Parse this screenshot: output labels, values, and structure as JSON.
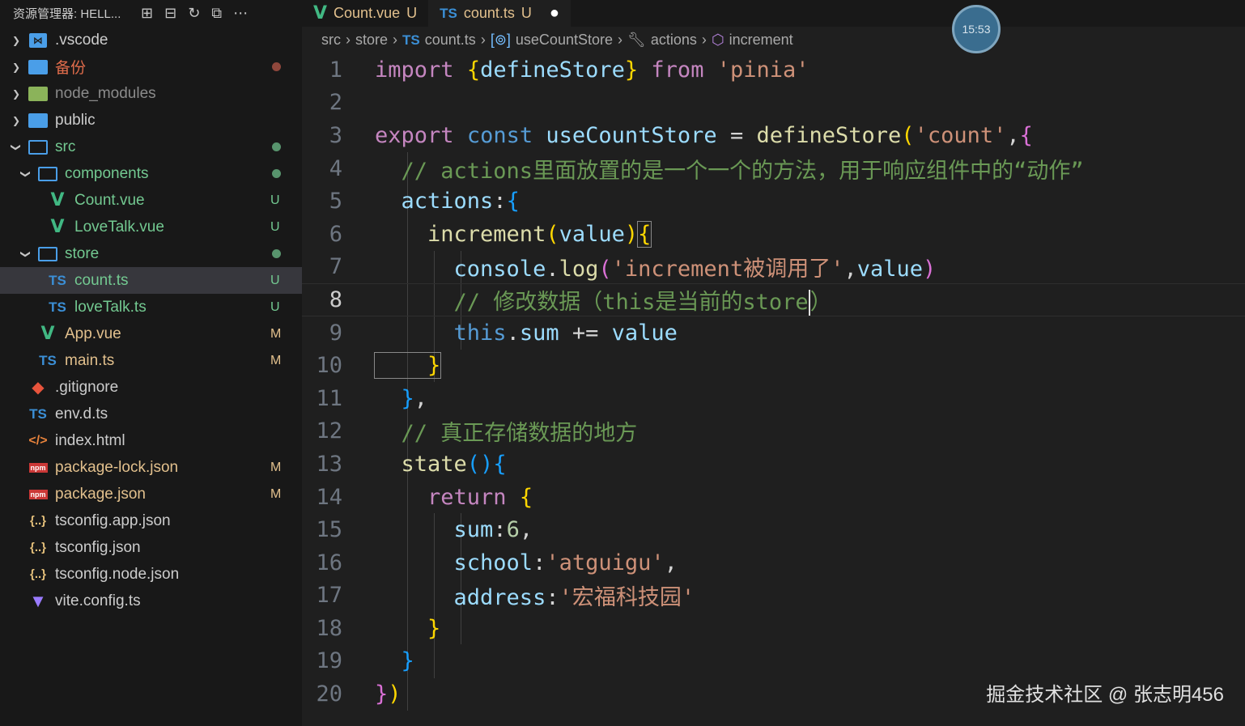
{
  "sidebar": {
    "title": "资源管理器: HELL...",
    "items": [
      {
        "label": ".vscode",
        "color": "#cccccc"
      },
      {
        "label": "备份",
        "color": "#e06c4b"
      },
      {
        "label": "node_modules",
        "color": "#8b8b8b"
      },
      {
        "label": "public",
        "color": "#cccccc"
      },
      {
        "label": "src",
        "color": "#73c991"
      },
      {
        "label": "components",
        "color": "#73c991"
      },
      {
        "label": "Count.vue",
        "color": "#73c991",
        "badge": "U"
      },
      {
        "label": "LoveTalk.vue",
        "color": "#73c991",
        "badge": "U"
      },
      {
        "label": "store",
        "color": "#73c991"
      },
      {
        "label": "count.ts",
        "color": "#73c991",
        "badge": "U"
      },
      {
        "label": "loveTalk.ts",
        "color": "#73c991",
        "badge": "U"
      },
      {
        "label": "App.vue",
        "color": "#e2c08d",
        "badge": "M"
      },
      {
        "label": "main.ts",
        "color": "#e2c08d",
        "badge": "M"
      },
      {
        "label": ".gitignore",
        "color": "#cccccc"
      },
      {
        "label": "env.d.ts",
        "color": "#cccccc"
      },
      {
        "label": "index.html",
        "color": "#cccccc"
      },
      {
        "label": "package-lock.json",
        "color": "#e2c08d",
        "badge": "M"
      },
      {
        "label": "package.json",
        "color": "#e2c08d",
        "badge": "M"
      },
      {
        "label": "tsconfig.app.json",
        "color": "#cccccc"
      },
      {
        "label": "tsconfig.json",
        "color": "#cccccc"
      },
      {
        "label": "tsconfig.node.json",
        "color": "#cccccc"
      },
      {
        "label": "vite.config.ts",
        "color": "#cccccc"
      }
    ]
  },
  "tabs": [
    {
      "label": "Count.vue",
      "status": "U"
    },
    {
      "label": "count.ts",
      "status": "U"
    }
  ],
  "breadcrumb": [
    "src",
    "store",
    "count.ts",
    "useCountStore",
    "actions",
    "increment"
  ],
  "code": {
    "line_numbers": [
      "1",
      "2",
      "3",
      "4",
      "5",
      "6",
      "7",
      "8",
      "9",
      "10",
      "11",
      "12",
      "13",
      "14",
      "15",
      "16",
      "17",
      "18",
      "19",
      "20"
    ],
    "current_line": "8"
  },
  "overlay": {
    "clock": "15:53",
    "watermark": "掘金技术社区 @ 张志明456"
  }
}
